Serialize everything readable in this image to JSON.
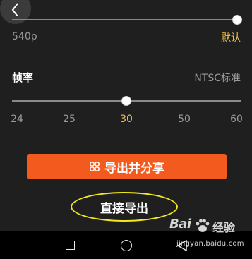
{
  "resolution": {
    "current_label": "540p",
    "default_label": "默认",
    "level_fraction": 1.0
  },
  "frame_rate": {
    "title": "帧率",
    "standard_label": "NTSC标准",
    "ticks": [
      "24",
      "25",
      "30",
      "50",
      "60"
    ],
    "selected": "30"
  },
  "actions": {
    "share_button_label": "导出并分享",
    "direct_export_label": "直接导出"
  },
  "navbar": {
    "items": [
      "recent-apps",
      "home",
      "back"
    ]
  },
  "watermark": {
    "brand_text": "Bai",
    "brand_suffix": "经验",
    "url": "jingyan.baidu.com"
  },
  "colors": {
    "background": "#1f1f1f",
    "accent_orange": "#f25a1e",
    "highlight_yellow": "#f0c14a",
    "annotation_yellow": "#f4e81c",
    "muted_text": "#9a9a9a"
  }
}
